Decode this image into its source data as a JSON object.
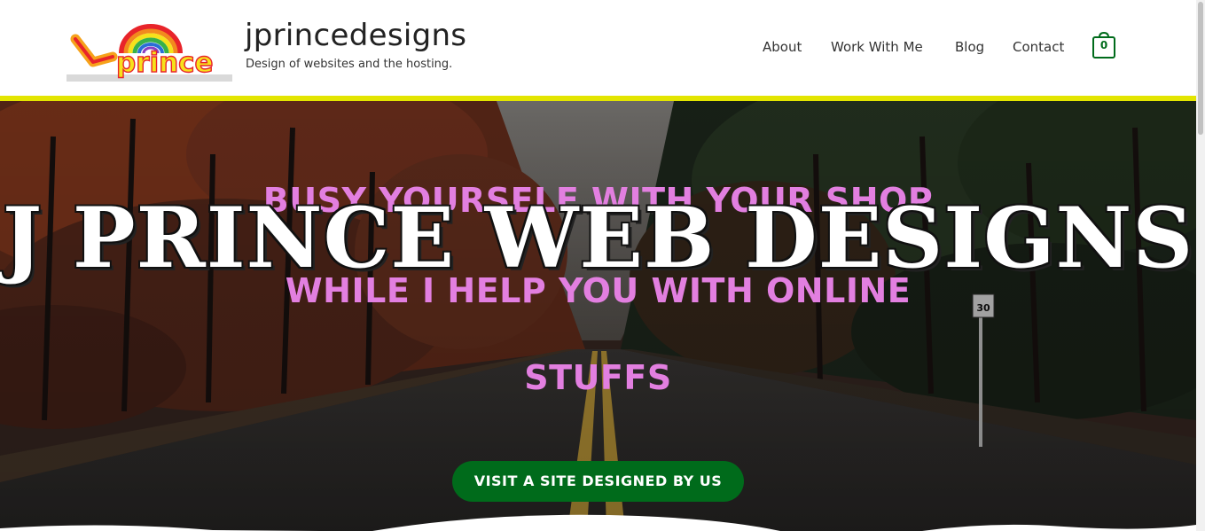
{
  "header": {
    "site_title": "jprincedesigns",
    "tagline": "Design of websites and the hosting.",
    "logo_text": "prince",
    "accent_color": "#e3e500"
  },
  "nav": {
    "items": [
      {
        "label": "About"
      },
      {
        "label": "Work With Me"
      },
      {
        "label": "Blog"
      },
      {
        "label": "Contact"
      }
    ],
    "cart_count": "0",
    "cart_icon": "shopping-bag-icon"
  },
  "hero": {
    "line1": "BUSY YOURSELF WITH YOUR SHOP",
    "line2": "WHILE I HELP YOU WITH ONLINE",
    "line3": "STUFFS",
    "overlay_title": "J PRINCE WEB DESIGNS",
    "cta_label": "VISIT A SITE DESIGNED BY US",
    "sign_text": "30",
    "text_color": "#e27fe0",
    "cta_color": "#006b1b"
  }
}
